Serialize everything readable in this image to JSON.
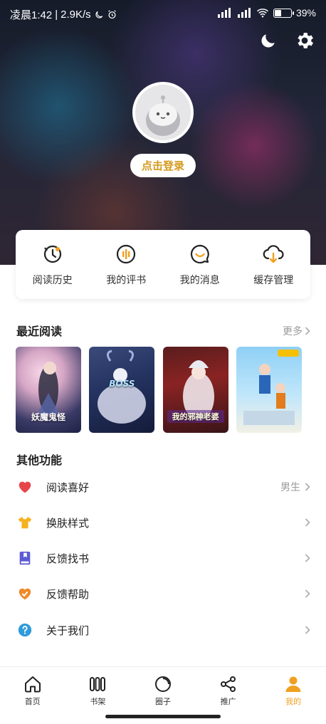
{
  "status_bar": {
    "time": "凌晨1:42",
    "network_speed": "2.9K/s",
    "battery_percent": "39%",
    "battery_level": 0.39
  },
  "header": {
    "login_label": "点击登录"
  },
  "quick_actions": [
    {
      "label": "阅读历史",
      "icon": "history-icon"
    },
    {
      "label": "我的评书",
      "icon": "audio-book-icon"
    },
    {
      "label": "我的消息",
      "icon": "message-icon"
    },
    {
      "label": "缓存管理",
      "icon": "cloud-download-icon"
    }
  ],
  "recent": {
    "title": "最近阅读",
    "more_label": "更多",
    "books": [
      {
        "cover_text": "妖魔鬼怪"
      },
      {
        "cover_text": "BOSS"
      },
      {
        "cover_text": "我的邪神老婆"
      },
      {
        "cover_text": ""
      }
    ]
  },
  "other": {
    "title": "其他功能",
    "items": [
      {
        "label": "阅读喜好",
        "value": "男生",
        "icon": "heart-icon"
      },
      {
        "label": "换肤样式",
        "value": "",
        "icon": "tshirt-icon"
      },
      {
        "label": "反馈找书",
        "value": "",
        "icon": "book-icon"
      },
      {
        "label": "反馈帮助",
        "value": "",
        "icon": "help-heart-icon"
      },
      {
        "label": "关于我们",
        "value": "",
        "icon": "question-icon"
      }
    ]
  },
  "bottom_nav": [
    {
      "label": "首页",
      "icon": "home-icon",
      "active": false
    },
    {
      "label": "书架",
      "icon": "bookshelf-icon",
      "active": false
    },
    {
      "label": "圈子",
      "icon": "circle-icon",
      "active": false
    },
    {
      "label": "推广",
      "icon": "share-icon",
      "active": false
    },
    {
      "label": "我的",
      "icon": "person-icon",
      "active": true
    }
  ],
  "colors": {
    "accent": "#f0a020",
    "login_text": "#d49a1e"
  }
}
